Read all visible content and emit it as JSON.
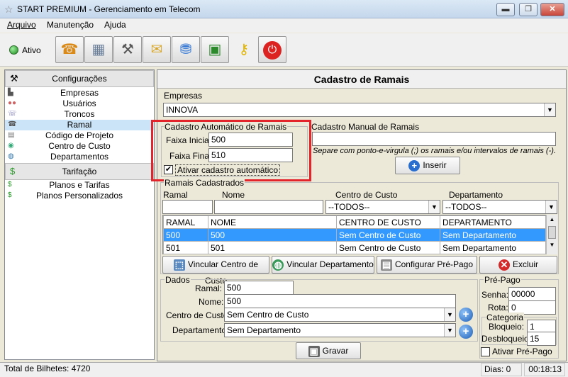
{
  "window": {
    "title": "START PREMIUM - Gerenciamento em Telecom",
    "min": "▬",
    "max": "❐",
    "close": "✕"
  },
  "menu": {
    "items": [
      "Arquivo",
      "Manutenção",
      "Ajuda"
    ]
  },
  "toolbar": {
    "status_label": "Ativo",
    "icons": [
      "phone-icon",
      "server-icon",
      "tools-icon",
      "mail-icon",
      "network-icon",
      "computer-icon",
      "key-icon",
      "power-icon"
    ]
  },
  "sidebar": {
    "config_header": "Configurações",
    "config_items": [
      "Empresas",
      "Usuários",
      "Troncos",
      "Ramal",
      "Código de Projeto",
      "Centro de Custo",
      "Departamentos"
    ],
    "tarif_header": "Tarifação",
    "tarif_items": [
      "Planos e Tarifas",
      "Planos Personalizados"
    ]
  },
  "main": {
    "title": "Cadastro de Ramais",
    "empresas": {
      "label": "Empresas",
      "value": "INNOVA"
    },
    "auto": {
      "title": "Cadastro Automático de Ramais",
      "faixa_inicial_label": "Faixa Inicial:",
      "faixa_inicial": "500",
      "faixa_final_label": "Faixa Final:",
      "faixa_final": "510",
      "ativar_label": "Ativar cadastro automático",
      "ativar_checked": true
    },
    "manual": {
      "title": "Cadastro Manual de Ramais",
      "value": "",
      "hint": "Separe com ponto-e-virgula (;) os ramais e/ou intervalos de ramais (-).",
      "insert_label": "Inserir"
    },
    "list": {
      "title": "Ramais Cadastrados",
      "filters": {
        "ramal_label": "Ramal",
        "nome_label": "Nome",
        "centro_label": "Centro de Custo",
        "depto_label": "Departamento",
        "ramal_value": "",
        "nome_value": "",
        "centro_value": "--TODOS--",
        "depto_value": "--TODOS--"
      },
      "columns": [
        "RAMAL",
        "NOME",
        "CENTRO DE CUSTO",
        "DEPARTAMENTO"
      ],
      "rows": [
        [
          "500",
          "500",
          "Sem Centro de Custo",
          "Sem Departamento"
        ],
        [
          "501",
          "501",
          "Sem Centro de Custo",
          "Sem Departamento"
        ]
      ]
    },
    "actions": {
      "vincular_centro": "Vincular Centro de Custo",
      "vincular_depto": "Vincular Departamento",
      "configurar": "Configurar Pré-Pago",
      "excluir": "Excluir"
    },
    "dados": {
      "title": "Dados",
      "ramal_label": "Ramal:",
      "ramal": "500",
      "nome_label": "Nome:",
      "nome": "500",
      "centro_label": "Centro de Custo:",
      "centro": "Sem Centro de Custo",
      "depto_label": "Departamento:",
      "depto": "Sem Departamento"
    },
    "prepago": {
      "title": "Pré-Pago",
      "senha_label": "Senha:",
      "senha": "00000",
      "rota_label": "Rota:",
      "rota": "0",
      "categoria_title": "Categoria",
      "bloqueio_label": "Bloqueio:",
      "bloqueio": "1",
      "desbloqueio_label": "Desbloqueio:",
      "desbloqueio": "15",
      "ativar_label": "Ativar Pré-Pago",
      "ativar_checked": false
    },
    "gravar_label": "Gravar"
  },
  "statusbar": {
    "total": "Total de Bilhetes: 4720",
    "dias": "Dias: 0",
    "time": "00:18:13"
  }
}
